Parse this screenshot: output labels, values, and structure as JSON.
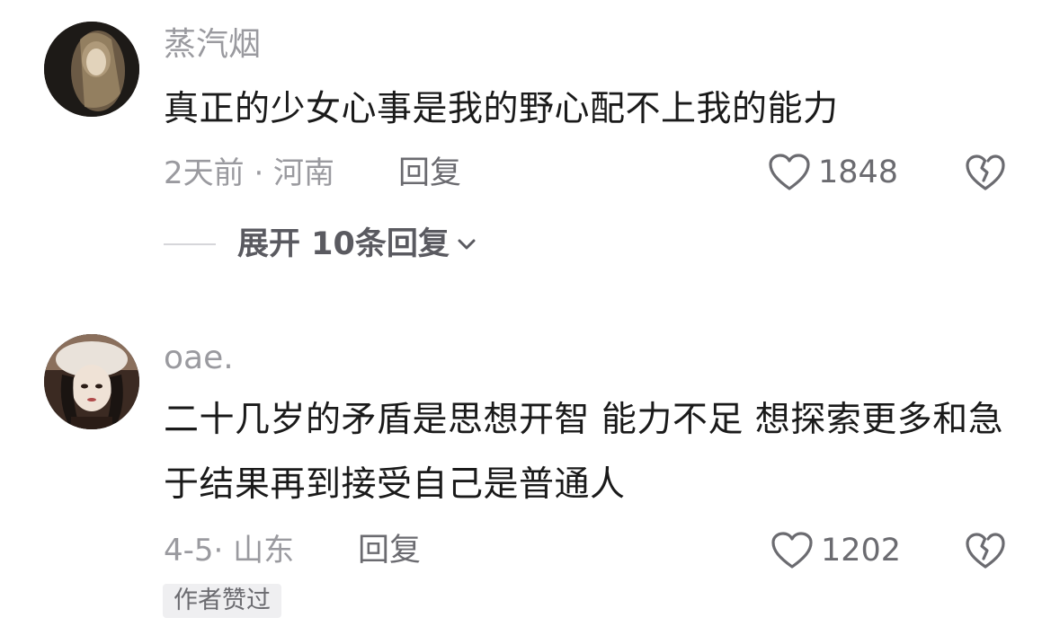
{
  "comments": [
    {
      "username": "蒸汽烟",
      "text": "真正的少女心事是我的野心配不上我的能力",
      "meta": "2天前 · 河南",
      "reply_label": "回复",
      "likes": "1848",
      "expand_label": "展开 10条回复"
    },
    {
      "username": "oae.",
      "text": "二十几岁的矛盾是思想开智 能力不足 想探索更多和急于结果再到接受自己是普通人",
      "meta": "4-5· 山东",
      "reply_label": "回复",
      "likes": "1202",
      "badge": "作者赞过"
    }
  ],
  "icons": {
    "like": "heart-outline-icon",
    "dislike": "broken-heart-icon",
    "expand": "chevron-down-icon"
  },
  "colors": {
    "muted": "#9a9a9f",
    "text": "#1a1a1a",
    "action": "#6b6b70"
  }
}
